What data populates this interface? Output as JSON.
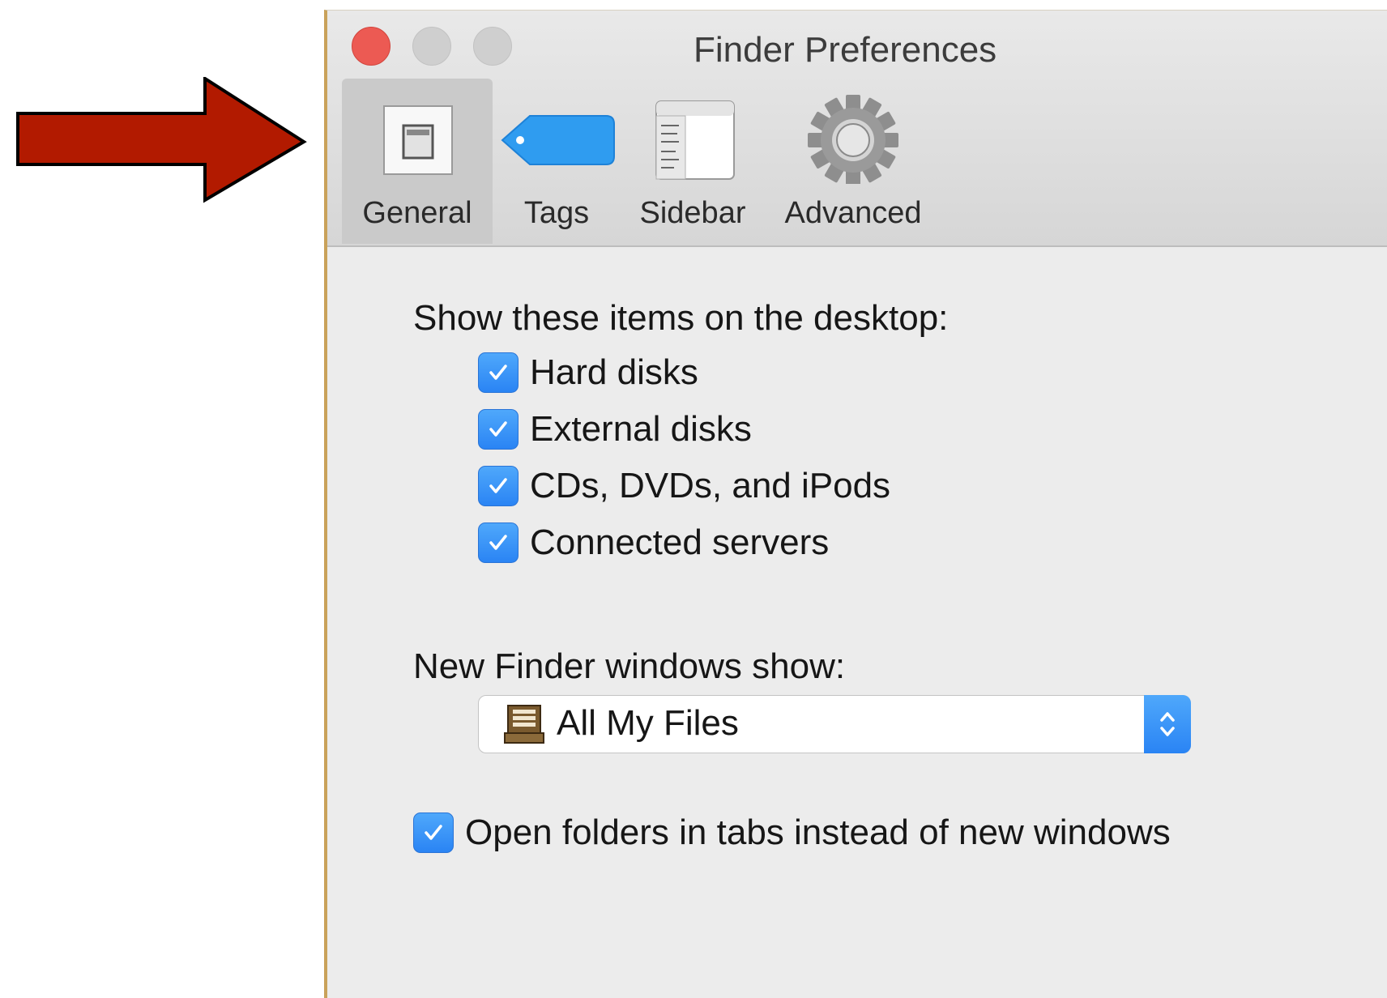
{
  "window": {
    "title": "Finder Preferences"
  },
  "toolbar": {
    "tabs": [
      {
        "label": "General",
        "icon": "switch-icon",
        "selected": true
      },
      {
        "label": "Tags",
        "icon": "tag-icon",
        "selected": false
      },
      {
        "label": "Sidebar",
        "icon": "sidebar-icon",
        "selected": false
      },
      {
        "label": "Advanced",
        "icon": "gear-icon",
        "selected": false
      }
    ]
  },
  "desktop_items": {
    "label": "Show these items on the desktop:",
    "options": [
      {
        "label": "Hard disks",
        "checked": true
      },
      {
        "label": "External disks",
        "checked": true
      },
      {
        "label": "CDs, DVDs, and iPods",
        "checked": true
      },
      {
        "label": "Connected servers",
        "checked": true
      }
    ]
  },
  "new_window": {
    "label": "New Finder windows show:",
    "selected": "All My Files",
    "icon": "all-my-files-icon"
  },
  "tabs_option": {
    "label": "Open folders in tabs instead of new windows",
    "checked": true
  },
  "colors": {
    "accent_blue": "#2a84f4",
    "close_red": "#ec5a53",
    "annotation_arrow": "#b21a00"
  }
}
